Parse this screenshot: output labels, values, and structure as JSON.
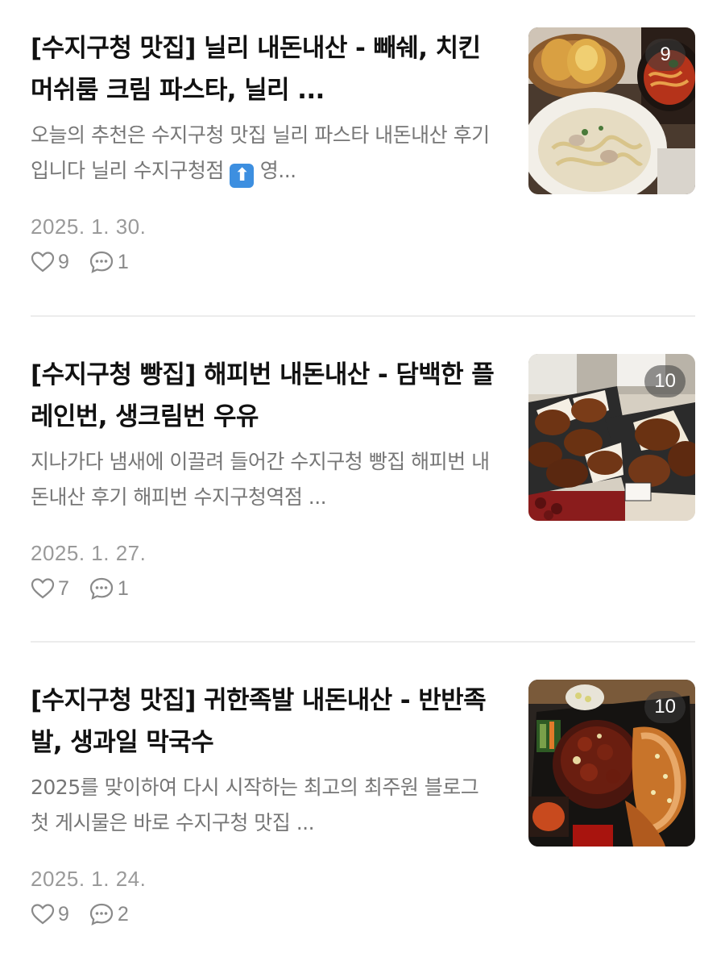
{
  "posts": [
    {
      "title": "[수지구청 맛집] 닐리 내돈내산 - 빼쉐, 치킨 머쉬룸 크림 파스타, 닐리 ...",
      "summary_before_emoji": "오늘의 추천은 수지구청 맛집 닐리 파스타 내돈내산 후기입니다 닐리 수지구청점 ",
      "summary_emoji": "⬆",
      "summary_after_emoji": " 영...",
      "date": "2025. 1. 30.",
      "likes": "9",
      "comments": "1",
      "image_count": "9",
      "thumbnail_icon": "pasta-and-garlic-bread-photo"
    },
    {
      "title": "[수지구청 빵집] 해피번 내돈내산 - 담백한 플레인번, 생크림번 우유",
      "summary": "지나가다 냄새에 이끌려 들어간 수지구청 빵집 해피번 내돈내산 후기 해피번 수지구청역점 ...",
      "date": "2025. 1. 27.",
      "likes": "7",
      "comments": "1",
      "image_count": "10",
      "thumbnail_icon": "bread-buns-photo"
    },
    {
      "title": "[수지구청 맛집] 귀한족발 내돈내산 - 반반족발, 생과일 막국수",
      "summary": "2025를 맞이하여 다시 시작하는 최고의 최주원 블로그 첫 게시물은 바로 수지구청 맛집 ...",
      "date": "2025. 1. 24.",
      "likes": "9",
      "comments": "2",
      "image_count": "10",
      "thumbnail_icon": "pork-feet-platter-photo"
    }
  ],
  "icons": {
    "like": "heart-icon",
    "comment": "comment-bubble-icon"
  },
  "colors": {
    "title": "#111111",
    "summary": "#767676",
    "date": "#9a9a9a",
    "meta": "#8a8a8a",
    "divider": "#ececec",
    "emoji_bg": "#3d8fe0"
  }
}
